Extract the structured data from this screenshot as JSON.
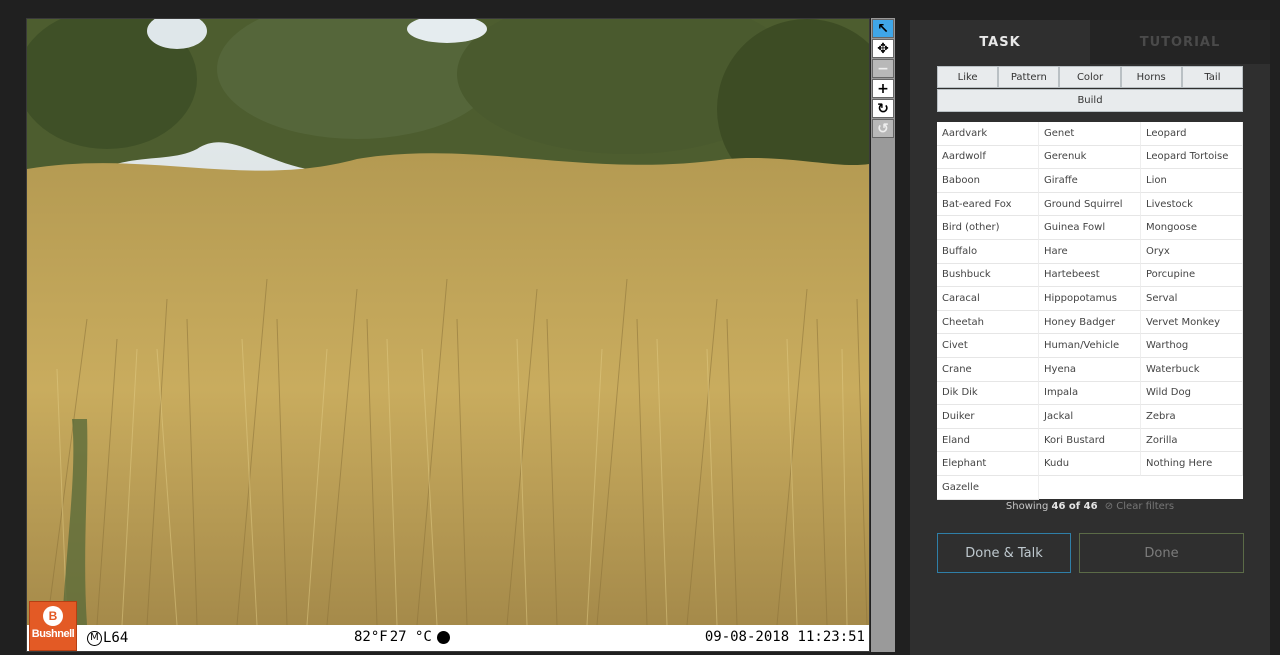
{
  "camera": {
    "brand": "Bushnell",
    "moon_phase": "M",
    "moon_label": "L64",
    "temp_f": "82°F",
    "temp_c": "27 °C",
    "timestamp": "09-08-2018 11:23:51"
  },
  "toolbar": {
    "icons": [
      "pointer-icon",
      "pan-icon",
      "zoom-out-icon",
      "zoom-in-icon",
      "rotate-icon",
      "reset-icon"
    ]
  },
  "tabs": [
    {
      "label": "TASK",
      "active": true
    },
    {
      "label": "TUTORIAL",
      "active": false
    }
  ],
  "filters": {
    "row1": [
      "Like",
      "Pattern",
      "Color",
      "Horns",
      "Tail"
    ],
    "build": "Build"
  },
  "species": [
    "Aardvark",
    "Genet",
    "Leopard",
    "Aardwolf",
    "Gerenuk",
    "Leopard Tortoise",
    "Baboon",
    "Giraffe",
    "Lion",
    "Bat-eared Fox",
    "Ground Squirrel",
    "Livestock",
    "Bird (other)",
    "Guinea Fowl",
    "Mongoose",
    "Buffalo",
    "Hare",
    "Oryx",
    "Bushbuck",
    "Hartebeest",
    "Porcupine",
    "Caracal",
    "Hippopotamus",
    "Serval",
    "Cheetah",
    "Honey Badger",
    "Vervet Monkey",
    "Civet",
    "Human/Vehicle",
    "Warthog",
    "Crane",
    "Hyena",
    "Waterbuck",
    "Dik Dik",
    "Impala",
    "Wild Dog",
    "Duiker",
    "Jackal",
    "Zebra",
    "Eland",
    "Kori Bustard",
    "Zorilla",
    "Elephant",
    "Kudu",
    "Nothing Here",
    "Gazelle"
  ],
  "status": {
    "prefix": "Showing",
    "count": "46 of 46",
    "clear": "Clear filters"
  },
  "actions": {
    "talk": "Done & Talk",
    "done": "Done"
  },
  "colors": {
    "accent_blue": "#3fa6e8",
    "brand_orange": "#e35a25",
    "done_border": "#5b6b47"
  }
}
